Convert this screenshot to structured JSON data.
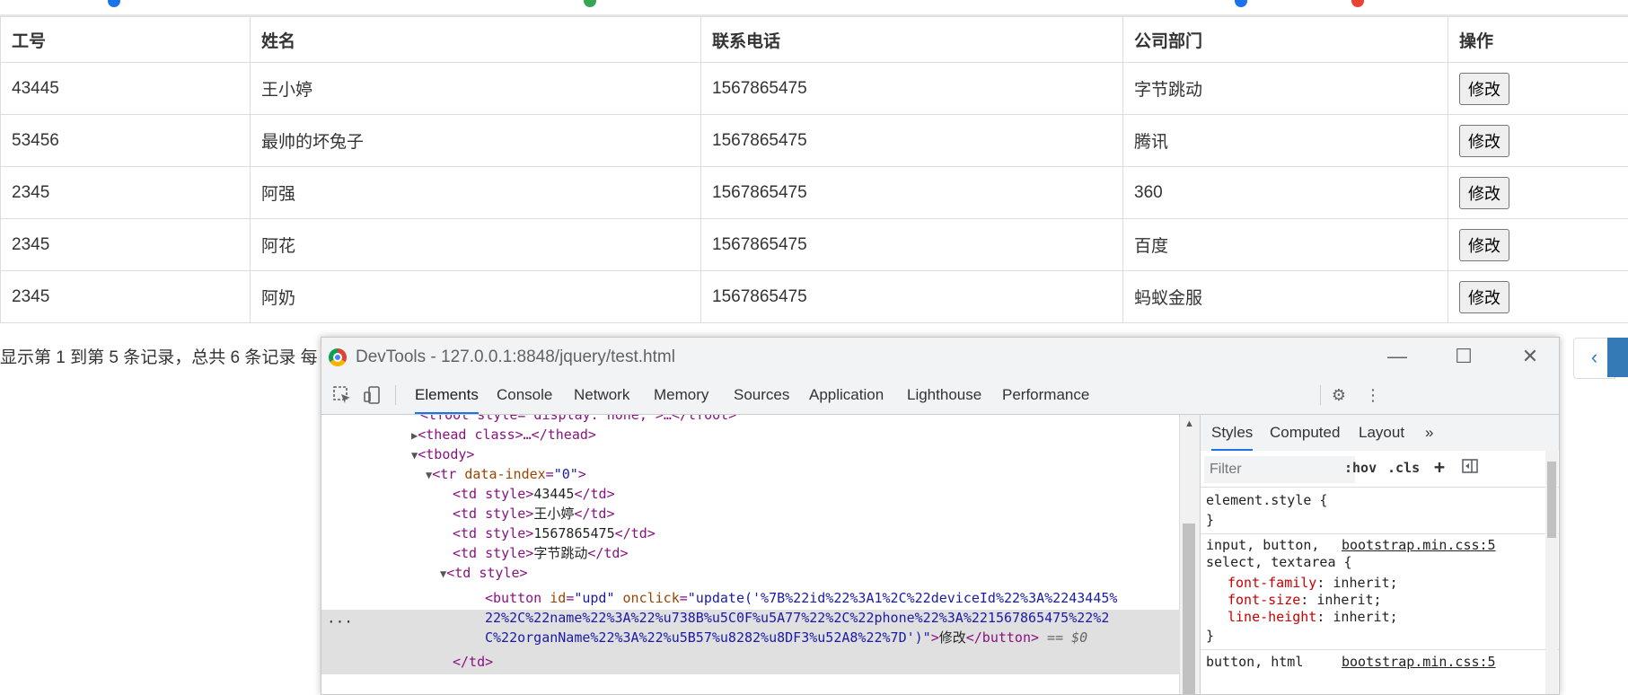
{
  "table": {
    "headers": [
      "工号",
      "姓名",
      "联系电话",
      "公司部门",
      "操作"
    ],
    "rows": [
      {
        "id": "43445",
        "name": "王小婷",
        "phone": "1567865475",
        "dept": "字节跳动",
        "action": "修改"
      },
      {
        "id": "53456",
        "name": "最帅的坏兔子",
        "phone": "1567865475",
        "dept": "腾讯",
        "action": "修改"
      },
      {
        "id": "2345",
        "name": "阿强",
        "phone": "1567865475",
        "dept": "360",
        "action": "修改"
      },
      {
        "id": "2345",
        "name": "阿花",
        "phone": "1567865475",
        "dept": "百度",
        "action": "修改"
      },
      {
        "id": "2345",
        "name": "阿奶",
        "phone": "1567865475",
        "dept": "蚂蚁金服",
        "action": "修改"
      }
    ]
  },
  "pagination": {
    "info": "显示第 1 到第 5 条记录，总共 6 条记录  每",
    "prev": "‹"
  },
  "devtools": {
    "title": "DevTools - 127.0.0.1:8848/jquery/test.html",
    "tabs": [
      "Elements",
      "Console",
      "Network",
      "Memory",
      "Sources",
      "Application",
      "Lighthouse",
      "Performance"
    ],
    "active_tab": "Elements",
    "code": {
      "l0": "<tfoot style=\"display: none;\">…</tfoot>",
      "l1_tag_open": "<thead class",
      "l1_rest": ">…</thead>",
      "l2": "<tbody>",
      "l3_tag": "<tr ",
      "l3_attr": "data-index",
      "l3_val": "\"0\"",
      "l3_close": ">",
      "td_open": "<td style",
      "td_close": "</td>",
      "td1": "43445",
      "td2": "王小婷",
      "td3": "1567865475",
      "td4": "字节跳动",
      "td5": "<td style>",
      "btn_tag": "<button ",
      "btn_id_attr": "id",
      "btn_id_val": "\"upd\"",
      "btn_onclick_attr": "onclick",
      "btn_onclick_val1": "\"update('%7B%22id%22%3A1%2C%22deviceId%22%3A%2243445%",
      "btn_onclick_val2": "22%2C%22name%22%3A%22%u738B%u5C0F%u5A77%22%2C%22phone%22%3A%221567865475%22%2",
      "btn_onclick_val3": "C%22organName%22%3A%22%u5B57%u8282%u8DF3%u52A8%22%7D')\"",
      "btn_text": "修改",
      "btn_close": "</button>",
      "btn_eq": " == $0",
      "td_end": "</td>",
      "ellipsis": "···"
    },
    "styles": {
      "tabs": [
        "Styles",
        "Computed",
        "Layout",
        "»"
      ],
      "filter_placeholder": "Filter",
      "hov": ":hov",
      "cls": ".cls",
      "plus": "+",
      "element_style": "element.style {",
      "brace_close": "}",
      "rule1_selector1": "input, button,",
      "rule1_selector2": "select, textarea {",
      "rule1_source": "bootstrap.min.css:5",
      "props": [
        {
          "name": "font-family",
          "value": "inherit;"
        },
        {
          "name": "font-size",
          "value": "inherit;"
        },
        {
          "name": "line-height",
          "value": "inherit;"
        }
      ],
      "rule2_selector": "button, html",
      "rule2_source": "bootstrap.min.css:5"
    }
  }
}
